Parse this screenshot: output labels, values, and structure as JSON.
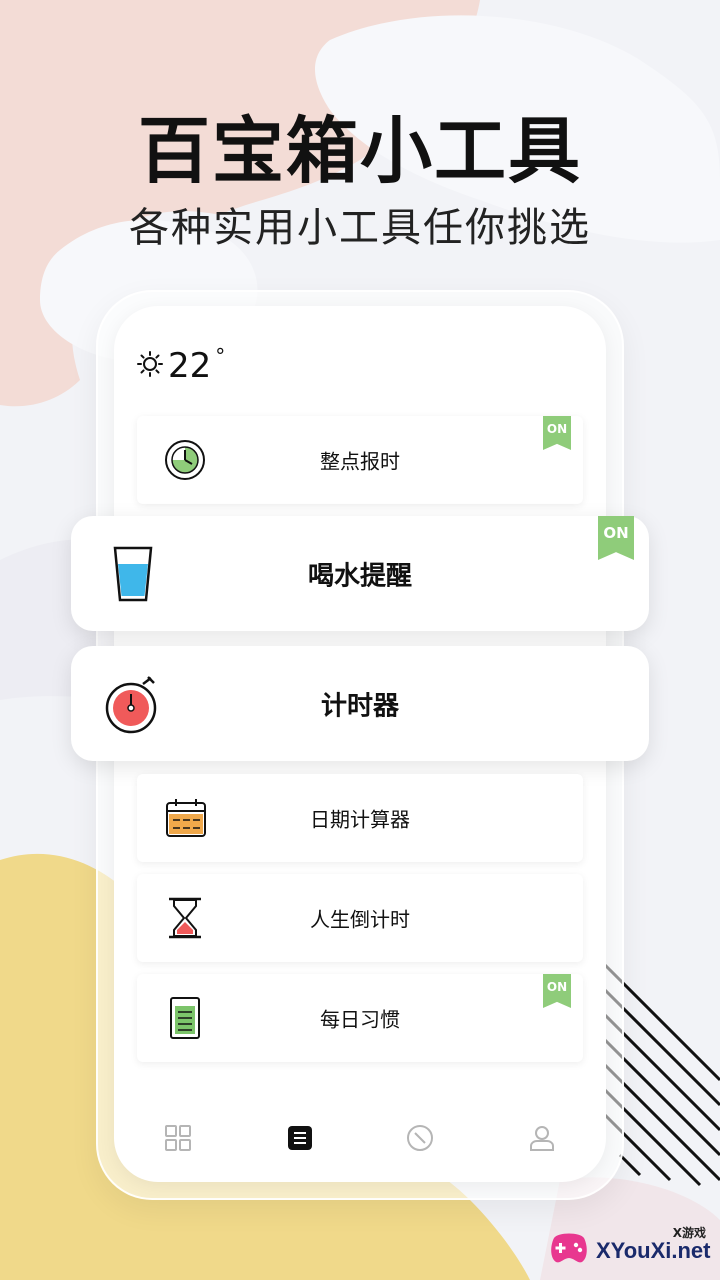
{
  "hero": {
    "title": "百宝箱小工具",
    "subtitle": "各种实用小工具任你挑选"
  },
  "weather": {
    "icon": "sun-icon",
    "temperature": "22",
    "degree_symbol": "°"
  },
  "tools": [
    {
      "label": "整点报时",
      "icon": "clock-icon",
      "badge": "ON"
    },
    {
      "label": "喝水提醒",
      "icon": "water-glass-icon",
      "badge": "ON"
    },
    {
      "label": "计时器",
      "icon": "stopwatch-icon"
    },
    {
      "label": "日期计算器",
      "icon": "calendar-icon"
    },
    {
      "label": "人生倒计时",
      "icon": "hourglass-icon"
    },
    {
      "label": "每日习惯",
      "icon": "habit-list-icon",
      "badge": "ON"
    }
  ],
  "tabbar": [
    {
      "icon": "grid-icon",
      "active": false
    },
    {
      "icon": "list-icon",
      "active": true
    },
    {
      "icon": "compass-icon",
      "active": false
    },
    {
      "icon": "user-icon",
      "active": false
    }
  ],
  "watermark": {
    "top_text": "X游戏",
    "main_text": "XYouXi.net"
  },
  "colors": {
    "badge_green": "#8fcc7a",
    "accent_red": "#f05a5a",
    "water_blue": "#3fb7ea",
    "calendar_orange": "#f0a84a",
    "habit_green": "#7cc46a",
    "blob_pink": "#f3dcd6",
    "blob_yellow": "#f0d98a"
  }
}
